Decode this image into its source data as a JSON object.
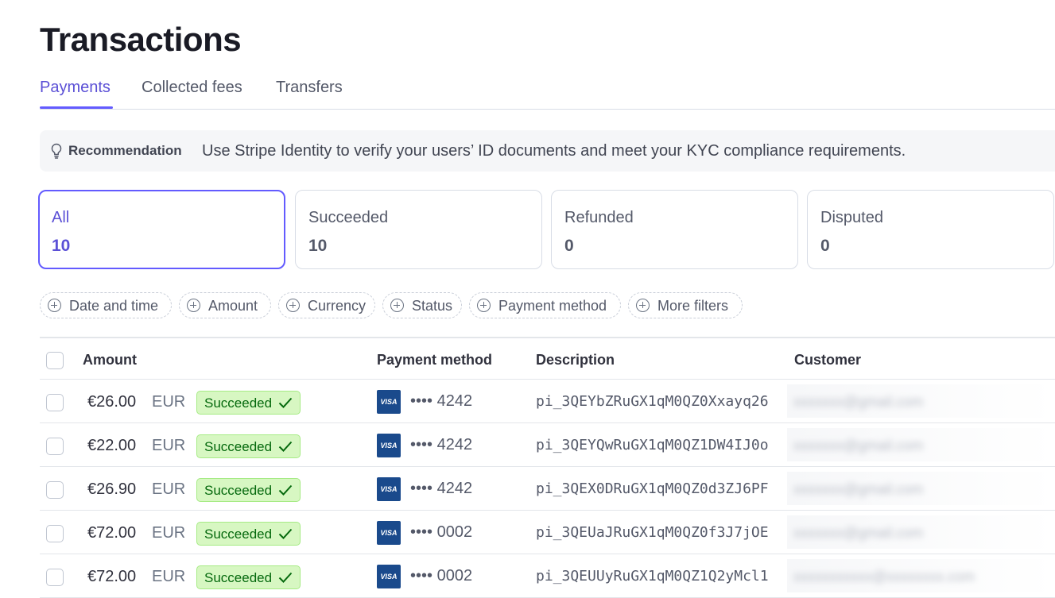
{
  "page": {
    "title": "Transactions"
  },
  "tabs": [
    {
      "label": "Payments"
    },
    {
      "label": "Collected fees"
    },
    {
      "label": "Transfers"
    }
  ],
  "recommendation": {
    "label": "Recommendation",
    "text": "Use Stripe Identity to verify your users’ ID documents and meet your KYC compliance requirements."
  },
  "status_cards": [
    {
      "label": "All",
      "count": "10"
    },
    {
      "label": "Succeeded",
      "count": "10"
    },
    {
      "label": "Refunded",
      "count": "0"
    },
    {
      "label": "Disputed",
      "count": "0"
    }
  ],
  "filters": [
    {
      "label": "Date and time"
    },
    {
      "label": "Amount"
    },
    {
      "label": "Currency"
    },
    {
      "label": "Status"
    },
    {
      "label": "Payment method"
    },
    {
      "label": "More filters"
    }
  ],
  "table": {
    "columns": {
      "amount": "Amount",
      "payment_method": "Payment method",
      "description": "Description",
      "customer": "Customer"
    },
    "rows": [
      {
        "amount": "€26.00",
        "currency": "EUR",
        "status": "Succeeded",
        "brand": "VISA",
        "dots": "••••",
        "last4": "4242",
        "description": "pi_3QEYbZRuGX1qM0QZ0Xxayq26",
        "customer": "xxxxxxx@gmail.com"
      },
      {
        "amount": "€22.00",
        "currency": "EUR",
        "status": "Succeeded",
        "brand": "VISA",
        "dots": "••••",
        "last4": "4242",
        "description": "pi_3QEYQwRuGX1qM0QZ1DW4IJ0o",
        "customer": "xxxxxxx@gmail.com"
      },
      {
        "amount": "€26.90",
        "currency": "EUR",
        "status": "Succeeded",
        "brand": "VISA",
        "dots": "••••",
        "last4": "4242",
        "description": "pi_3QEX0DRuGX1qM0QZ0d3ZJ6PF",
        "customer": "xxxxxxx@gmail.com"
      },
      {
        "amount": "€72.00",
        "currency": "EUR",
        "status": "Succeeded",
        "brand": "VISA",
        "dots": "••••",
        "last4": "0002",
        "description": "pi_3QEUaJRuGX1qM0QZ0f3J7jOE",
        "customer": "xxxxxxx@gmail.com"
      },
      {
        "amount": "€72.00",
        "currency": "EUR",
        "status": "Succeeded",
        "brand": "VISA",
        "dots": "••••",
        "last4": "0002",
        "description": "pi_3QEUUyRuGX1qM0QZ1Q2yMcl1",
        "customer": "xxxxxxxxxxx@xxxxxxxx.com"
      }
    ]
  },
  "colors": {
    "accent": "#635bff",
    "success_bg": "#d7f7c2",
    "success_text": "#05690d",
    "visa": "#1a4a8c"
  }
}
